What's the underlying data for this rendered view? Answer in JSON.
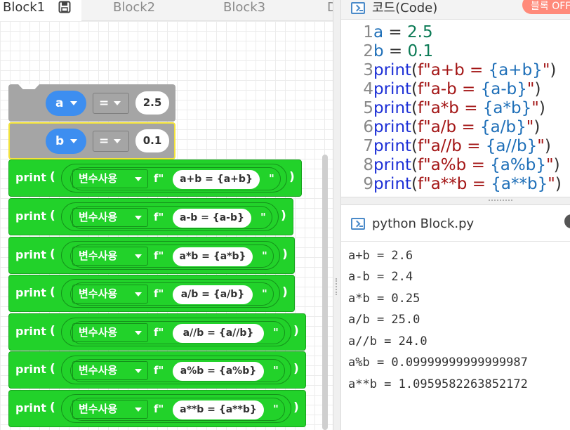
{
  "tabs": [
    {
      "label": "Block1",
      "active": true
    },
    {
      "label": "Block2",
      "active": false
    },
    {
      "label": "Block3",
      "active": false
    },
    {
      "label": "D",
      "active": false
    }
  ],
  "icons": {
    "save": "save-icon",
    "terminal": "terminal-icon",
    "dropdown": "chevron-down-icon"
  },
  "blocks": {
    "assign": [
      {
        "var": "a",
        "op": "=",
        "value": "2.5"
      },
      {
        "var": "b",
        "op": "=",
        "value": "0.1"
      }
    ],
    "print_keyword": "print",
    "paren_open": "(",
    "paren_close": ")",
    "use_var_label": "변수사용",
    "f_prefix": "f\"",
    "close_quote": "\"",
    "prints": [
      {
        "fmt": "a+b = {a+b}"
      },
      {
        "fmt": "a-b = {a-b}"
      },
      {
        "fmt": "a*b = {a*b}"
      },
      {
        "fmt": "a/b = {a/b}"
      },
      {
        "fmt": "a//b = {a//b}"
      },
      {
        "fmt": "a%b = {a%b}"
      },
      {
        "fmt": "a**b = {a**b}"
      }
    ]
  },
  "code_panel": {
    "title": "코드(Code)",
    "toggle_label": "블록 OFF",
    "lines": [
      {
        "n": "1",
        "parts": [
          [
            "var",
            "a"
          ],
          [
            "op",
            " = "
          ],
          [
            "num",
            "2.5"
          ]
        ]
      },
      {
        "n": "2",
        "parts": [
          [
            "var",
            "b"
          ],
          [
            "op",
            " = "
          ],
          [
            "num",
            "0.1"
          ]
        ]
      },
      {
        "n": "3",
        "parts": [
          [
            "kw",
            "print"
          ],
          [
            "op",
            "("
          ],
          [
            "str",
            "f\"a+b = "
          ],
          [
            "var",
            "{a+b}"
          ],
          [
            "str",
            "\""
          ],
          [
            "op",
            ")"
          ]
        ]
      },
      {
        "n": "4",
        "parts": [
          [
            "kw",
            "print"
          ],
          [
            "op",
            "("
          ],
          [
            "str",
            "f\"a-b = "
          ],
          [
            "var",
            "{a-b}"
          ],
          [
            "str",
            "\""
          ],
          [
            "op",
            ")"
          ]
        ]
      },
      {
        "n": "5",
        "parts": [
          [
            "kw",
            "print"
          ],
          [
            "op",
            "("
          ],
          [
            "str",
            "f\"a*b = "
          ],
          [
            "var",
            "{a*b}"
          ],
          [
            "str",
            "\""
          ],
          [
            "op",
            ")"
          ]
        ]
      },
      {
        "n": "6",
        "parts": [
          [
            "kw",
            "print"
          ],
          [
            "op",
            "("
          ],
          [
            "str",
            "f\"a/b = "
          ],
          [
            "var",
            "{a/b}"
          ],
          [
            "str",
            "\""
          ],
          [
            "op",
            ")"
          ]
        ]
      },
      {
        "n": "7",
        "parts": [
          [
            "kw",
            "print"
          ],
          [
            "op",
            "("
          ],
          [
            "str",
            "f\"a//b = "
          ],
          [
            "var",
            "{a//b}"
          ],
          [
            "str",
            "\""
          ],
          [
            "op",
            ")"
          ]
        ]
      },
      {
        "n": "8",
        "parts": [
          [
            "kw",
            "print"
          ],
          [
            "op",
            "("
          ],
          [
            "str",
            "f\"a%b = "
          ],
          [
            "var",
            "{a%b}"
          ],
          [
            "str",
            "\""
          ],
          [
            "op",
            ")"
          ]
        ]
      },
      {
        "n": "9",
        "parts": [
          [
            "kw",
            "print"
          ],
          [
            "op",
            "("
          ],
          [
            "str",
            "f\"a**b = "
          ],
          [
            "var",
            "{a**b}"
          ],
          [
            "str",
            "\""
          ],
          [
            "op",
            ")"
          ]
        ]
      }
    ]
  },
  "output_panel": {
    "title": "python Block.py",
    "lines": [
      "a+b = 2.6",
      "a-b = 2.4",
      "a*b = 0.25",
      "a/b = 25.0",
      "a//b = 24.0",
      "a%b = 0.09999999999999987",
      "a**b = 1.0959582263852172"
    ]
  },
  "colors": {
    "block_green": "#22d22a",
    "block_gray": "#a5a5a5",
    "var_blue": "#3d8ef0",
    "selected_outline": "#f3e33a",
    "toggle_red": "#ff8a7a"
  }
}
